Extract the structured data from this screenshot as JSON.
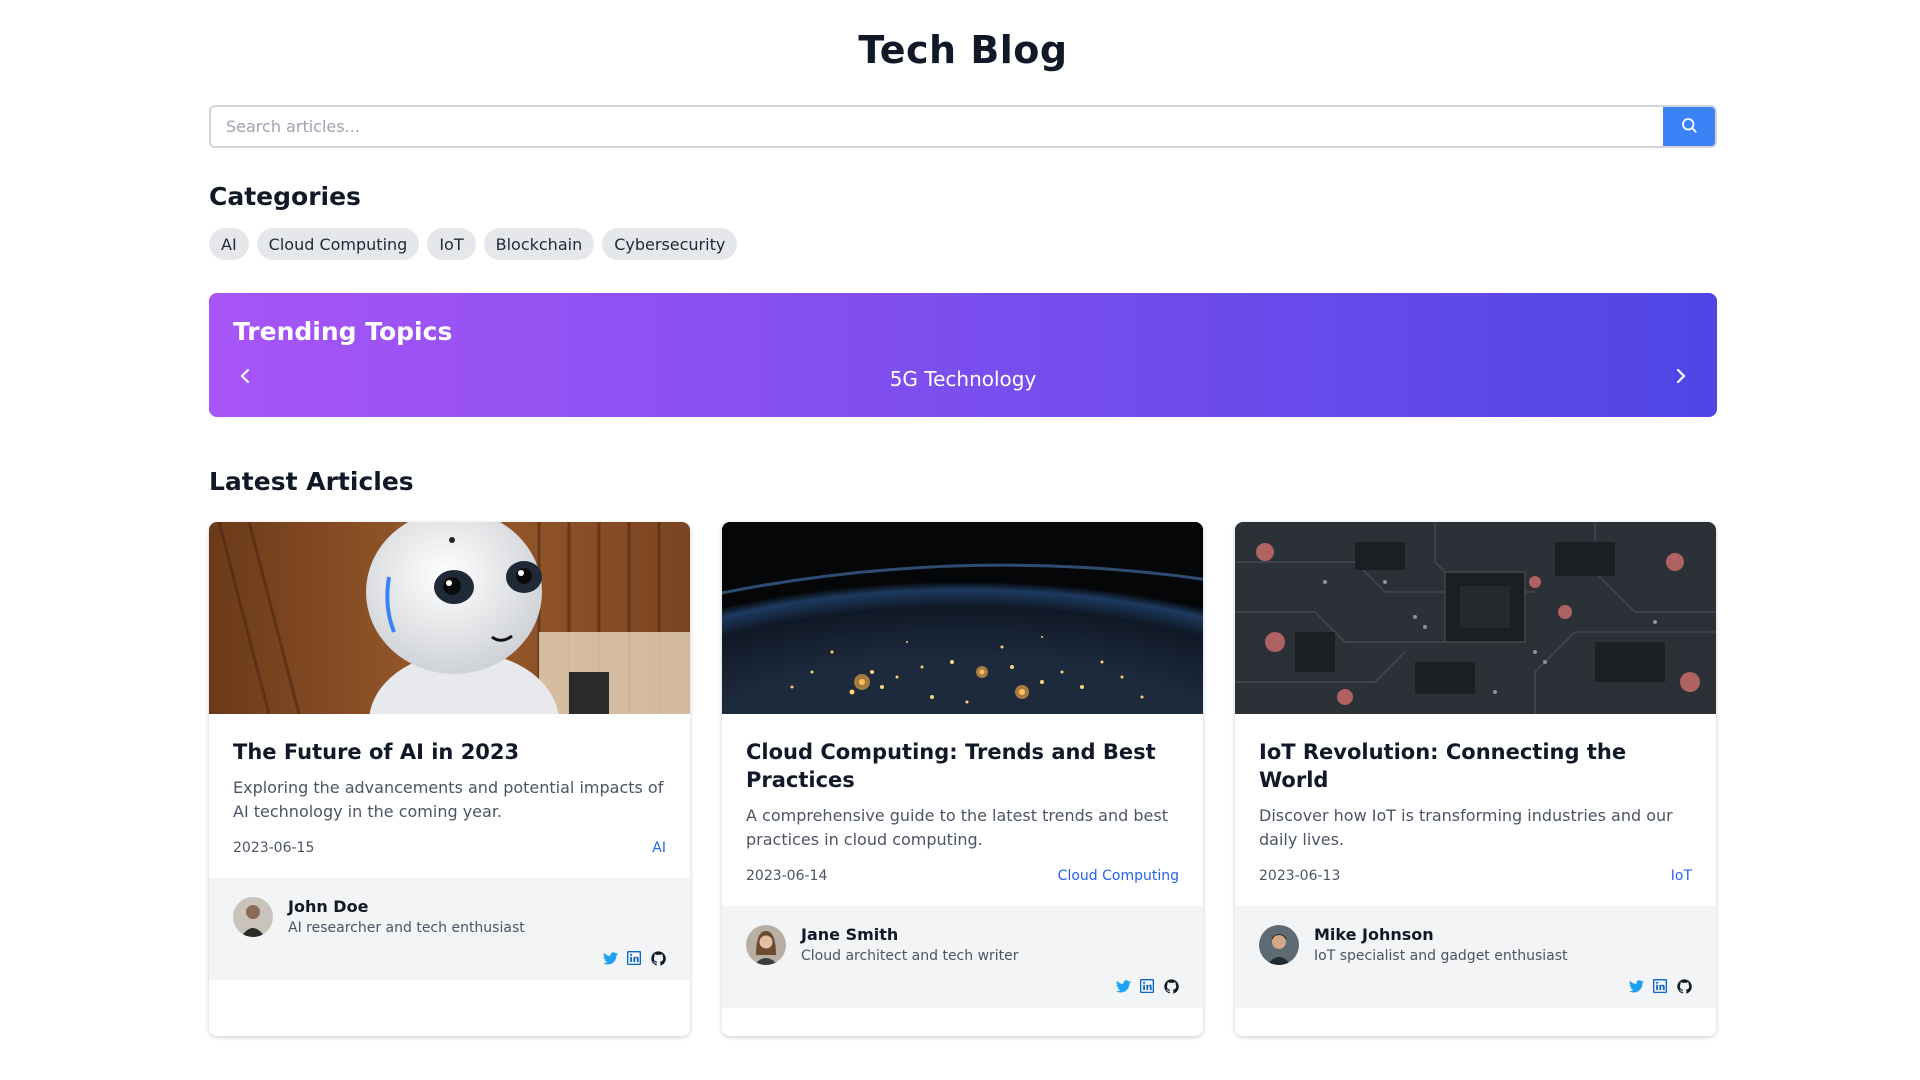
{
  "header": {
    "title": "Tech Blog"
  },
  "search": {
    "placeholder": "Search articles...",
    "value": ""
  },
  "categories": {
    "heading": "Categories",
    "items": [
      "AI",
      "Cloud Computing",
      "IoT",
      "Blockchain",
      "Cybersecurity"
    ]
  },
  "trending": {
    "heading": "Trending Topics",
    "current_topic": "5G Technology",
    "gradient_start": "#a855f7",
    "gradient_end": "#4f46e5"
  },
  "latest": {
    "heading": "Latest Articles",
    "articles": [
      {
        "title": "The Future of AI in 2023",
        "excerpt": "Exploring the advancements and potential impacts of AI technology in the coming year.",
        "date": "2023-06-15",
        "category": "AI",
        "image": "robot-photo",
        "author": {
          "name": "John Doe",
          "bio": "AI researcher and tech enthusiast"
        }
      },
      {
        "title": "Cloud Computing: Trends and Best Practices",
        "excerpt": "A comprehensive guide to the latest trends and best practices in cloud computing.",
        "date": "2023-06-14",
        "category": "Cloud Computing",
        "image": "earth-night-photo",
        "author": {
          "name": "Jane Smith",
          "bio": "Cloud architect and tech writer"
        }
      },
      {
        "title": "IoT Revolution: Connecting the World",
        "excerpt": "Discover how IoT is transforming industries and our daily lives.",
        "date": "2023-06-13",
        "category": "IoT",
        "image": "circuit-board-photo",
        "author": {
          "name": "Mike Johnson",
          "bio": "IoT specialist and gadget enthusiast"
        }
      }
    ]
  },
  "icons": {
    "search": "search-icon",
    "prev": "chevron-left-icon",
    "next": "chevron-right-icon",
    "social": [
      "twitter-icon",
      "linkedin-icon",
      "github-icon"
    ]
  },
  "colors": {
    "accent": "#3b82f6",
    "link": "#2563eb",
    "chip_bg": "#e5e7eb",
    "author_bg": "#f3f4f6",
    "twitter": "#1da1f2",
    "linkedin": "#0a66c2",
    "github": "#111827"
  }
}
